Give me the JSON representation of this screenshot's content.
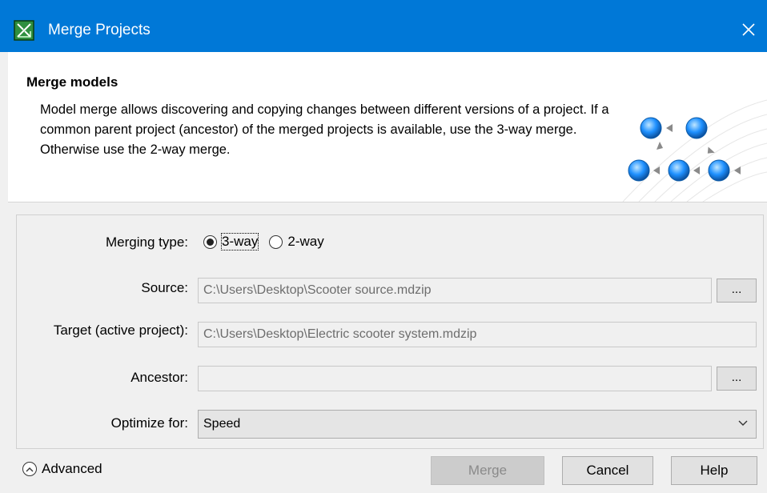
{
  "window": {
    "title": "Merge Projects",
    "close_glyph": "✕",
    "app_icon": "merge-projects-app-icon"
  },
  "header": {
    "heading": "Merge models",
    "description": "Model merge allows discovering and copying changes between different versions of a project. If a common parent project (ancestor) of the merged projects is available, use the 3-way merge. Otherwise use the 2-way merge."
  },
  "form": {
    "merging_type": {
      "label": "Merging type:",
      "options": [
        "3-way",
        "2-way"
      ],
      "selected": "3-way"
    },
    "source": {
      "label": "Source:",
      "value": "C:\\Users\\Desktop\\Scooter source.mdzip",
      "browse_label": "..."
    },
    "target": {
      "label": "Target (active project):",
      "value": "C:\\Users\\Desktop\\Electric scooter system.mdzip"
    },
    "ancestor": {
      "label": "Ancestor:",
      "value": "",
      "browse_label": "..."
    },
    "optimize": {
      "label": "Optimize for:",
      "value": "Speed"
    }
  },
  "footer": {
    "advanced_label": "Advanced",
    "merge_label": "Merge",
    "cancel_label": "Cancel",
    "help_label": "Help"
  },
  "colors": {
    "titlebar": "#0078d7",
    "dialog_bg": "#f0f0f0",
    "header_bg": "#ffffff",
    "node_blue": "#1e90ff"
  }
}
